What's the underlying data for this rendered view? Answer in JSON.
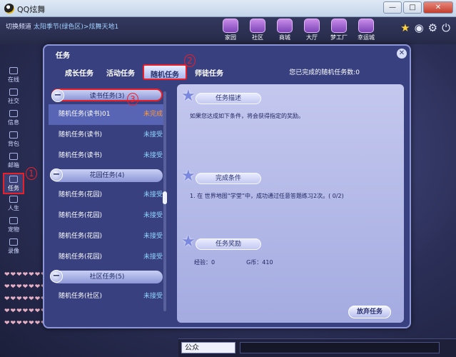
{
  "window": {
    "title": "QQ炫舞",
    "minimize": "—",
    "maximize": "□",
    "close": "✕"
  },
  "header": {
    "channel_prefix": "切换频道",
    "channel_path": "太阳季节(绿色区)>炫舞天地1",
    "nav": [
      {
        "label": "家园"
      },
      {
        "label": "社区"
      },
      {
        "label": "商城"
      },
      {
        "label": "大厅"
      },
      {
        "label": "梦工厂"
      },
      {
        "label": "幸运城"
      }
    ]
  },
  "rail": [
    {
      "label": "在线"
    },
    {
      "label": "社交"
    },
    {
      "label": "信息"
    },
    {
      "label": "背包"
    },
    {
      "label": "邮箱"
    },
    {
      "label": "任务"
    },
    {
      "label": "人生"
    },
    {
      "label": "宠物"
    },
    {
      "label": "录像"
    }
  ],
  "task_window": {
    "title": "任务",
    "tabs": [
      {
        "label": "成长任务",
        "active": false
      },
      {
        "label": "活动任务",
        "active": false
      },
      {
        "label": "随机任务",
        "active": true
      },
      {
        "label": "师徒任务",
        "active": false
      }
    ],
    "completed_label": "您已完成的随机任务数:0",
    "categories": [
      {
        "title": "读书任务(3)",
        "tasks": [
          {
            "name": "随机任务(读书)01",
            "status": "未完成"
          },
          {
            "name": "随机任务(读书)",
            "status": "未接受"
          },
          {
            "name": "随机任务(读书)",
            "status": "未接受"
          }
        ]
      },
      {
        "title": "花园任务(4)",
        "tasks": [
          {
            "name": "随机任务(花园)",
            "status": "未接受"
          },
          {
            "name": "随机任务(花园)",
            "status": "未接受"
          },
          {
            "name": "随机任务(花园)",
            "status": "未接受"
          },
          {
            "name": "随机任务(花园)",
            "status": "未接受"
          }
        ]
      },
      {
        "title": "社区任务(5)",
        "tasks": [
          {
            "name": "随机任务(社区)",
            "status": "未接受"
          }
        ]
      }
    ],
    "detail": {
      "desc_head": "任务描述",
      "desc_text": "如果您达成如下条件，将会获得指定的奖励。",
      "cond_head": "完成条件",
      "cond_text": "1. 在 世界地图“学堂”中，成功通过任意答题练习2次。( 0/2)",
      "reward_head": "任务奖励",
      "reward_exp": "经验：0",
      "reward_gb": "G币：410"
    },
    "giveup_label": "放弃任务"
  },
  "annotations": {
    "one": "1",
    "two": "2",
    "three": "3"
  },
  "bottom": {
    "channel_select": "公众"
  }
}
